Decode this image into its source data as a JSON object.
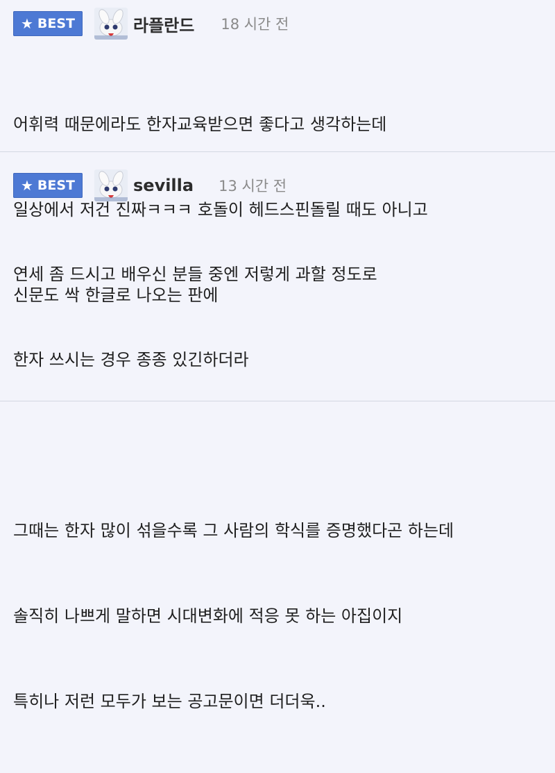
{
  "comments": [
    {
      "badge": "BEST",
      "author": "라플란드",
      "time": "18 시간 전",
      "lines": [
        "어휘력 때문에라도 한자교육받으면 좋다고 생각하는데",
        "일상에서 저건 진짜ㅋㅋㅋ 호돌이 헤드스핀돌릴 때도 아니고",
        "신문도 싹 한글로 나오는 판에"
      ]
    },
    {
      "badge": "BEST",
      "author": "sevilla",
      "time": "13 시간 전",
      "lines": [
        "연세 좀 드시고 배우신 분들 중엔 저렇게 과할 정도로",
        "한자 쓰시는 경우 종종 있긴하더라",
        "",
        "그때는 한자 많이 섞을수록 그 사람의 학식를 증명했다곤 하는데",
        "솔직히 나쁘게 말하면 시대변화에 적응 못 하는 아집이지",
        "특히나 저런 모두가 보는 공고문이면 더더욱.."
      ]
    }
  ],
  "colors": {
    "badge": "#4d79d4",
    "background": "#f3f4fb",
    "divider": "#d4d7e2"
  },
  "icons": {
    "badge_icon": "star-icon",
    "avatar": "rabbit-avatar"
  }
}
